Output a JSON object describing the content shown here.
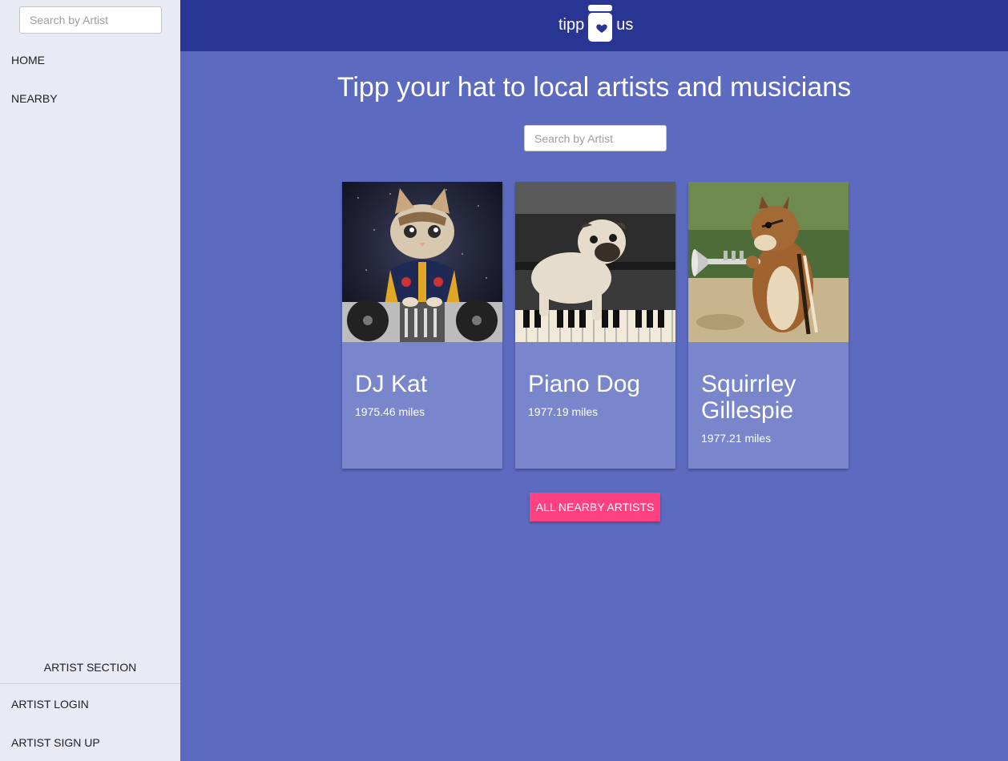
{
  "sidebar": {
    "search_placeholder": "Search by Artist",
    "nav": [
      {
        "label": "HOME"
      },
      {
        "label": "NEARBY"
      }
    ],
    "section_title": "ARTIST SECTION",
    "artist_links": [
      {
        "label": "ARTIST LOGIN"
      },
      {
        "label": "ARTIST SIGN UP"
      }
    ]
  },
  "header": {
    "logo_left": "tipp",
    "logo_right": "us",
    "logo_icon": "tip-jar-heart-icon",
    "background": "#283593"
  },
  "main": {
    "headline": "Tipp your hat to local artists and musicians",
    "search_placeholder": "Search by Artist",
    "artists": [
      {
        "name": "DJ Kat",
        "distance": "1975.46 miles",
        "image": "kitten-dj-image"
      },
      {
        "name": "Piano Dog",
        "distance": "1977.19 miles",
        "image": "pug-piano-image"
      },
      {
        "name": "Squirrley Gillespie",
        "distance": "1977.21 miles",
        "image": "chipmunk-trumpet-image"
      }
    ],
    "cta_label": "ALL NEARBY ARTISTS"
  },
  "colors": {
    "sidebar_bg": "#e8eaf6",
    "main_bg": "#5c6bc0",
    "card_bg": "#7986cb",
    "accent": "#ff4081"
  }
}
